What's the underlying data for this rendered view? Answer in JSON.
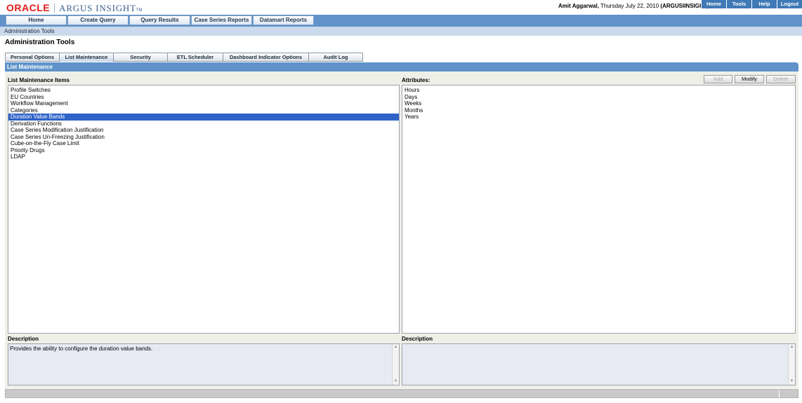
{
  "header": {
    "logo_brand": "ORACLE",
    "logo_product": "ARGUS INSIGHT",
    "logo_tm": "TM",
    "user_name": "Amit Aggarwal,",
    "date_text": "Thursday July 22, 2010",
    "system_text": "(ARGUSIINSIGHT)",
    "global_links": [
      "Home",
      "Tools",
      "Help",
      "Logout"
    ]
  },
  "main_nav": [
    "Home",
    "Create Query",
    "Query Results",
    "Case Series Reports",
    "Datamart Reports"
  ],
  "breadcrumb": "Administration Tools",
  "page_title": "Administration Tools",
  "tabs": [
    "Personal Options",
    "List Maintenance",
    "Security",
    "ETL Scheduler",
    "Dashboard Indicator Options",
    "Audit Log"
  ],
  "active_tab": "List Maintenance",
  "section_title": "List Maintenance",
  "left_panel": {
    "label": "List Maintenance Items",
    "items": [
      "Profile Switches",
      "EU Countries",
      "Workflow Management",
      "Categories",
      "Duration Value Bands",
      "Derivation Functions",
      "Case Series Modification Justification",
      "Case Series Un-Freezing Justification",
      "Cube-on-the-Fly Case Limit",
      "Priority Drugs",
      "LDAP"
    ],
    "selected_item": "Duration Value Bands",
    "description_label": "Description",
    "description_text": "Provides the ability to configure the duration value bands."
  },
  "right_panel": {
    "label": "Attributes:",
    "buttons": {
      "add": "Add",
      "modify": "Modify",
      "delete": "Delete"
    },
    "items": [
      "Hours",
      "Days",
      "Weeks",
      "Months",
      "Years"
    ],
    "description_label": "Description",
    "description_text": ""
  },
  "colors": {
    "nav_blue": "#5f93c9",
    "selection_blue": "#2f63c8",
    "oracle_red": "#e01a1a",
    "content_bg": "#eef0e8"
  },
  "icons": [
    "scroll-up-icon",
    "scroll-down-icon"
  ]
}
